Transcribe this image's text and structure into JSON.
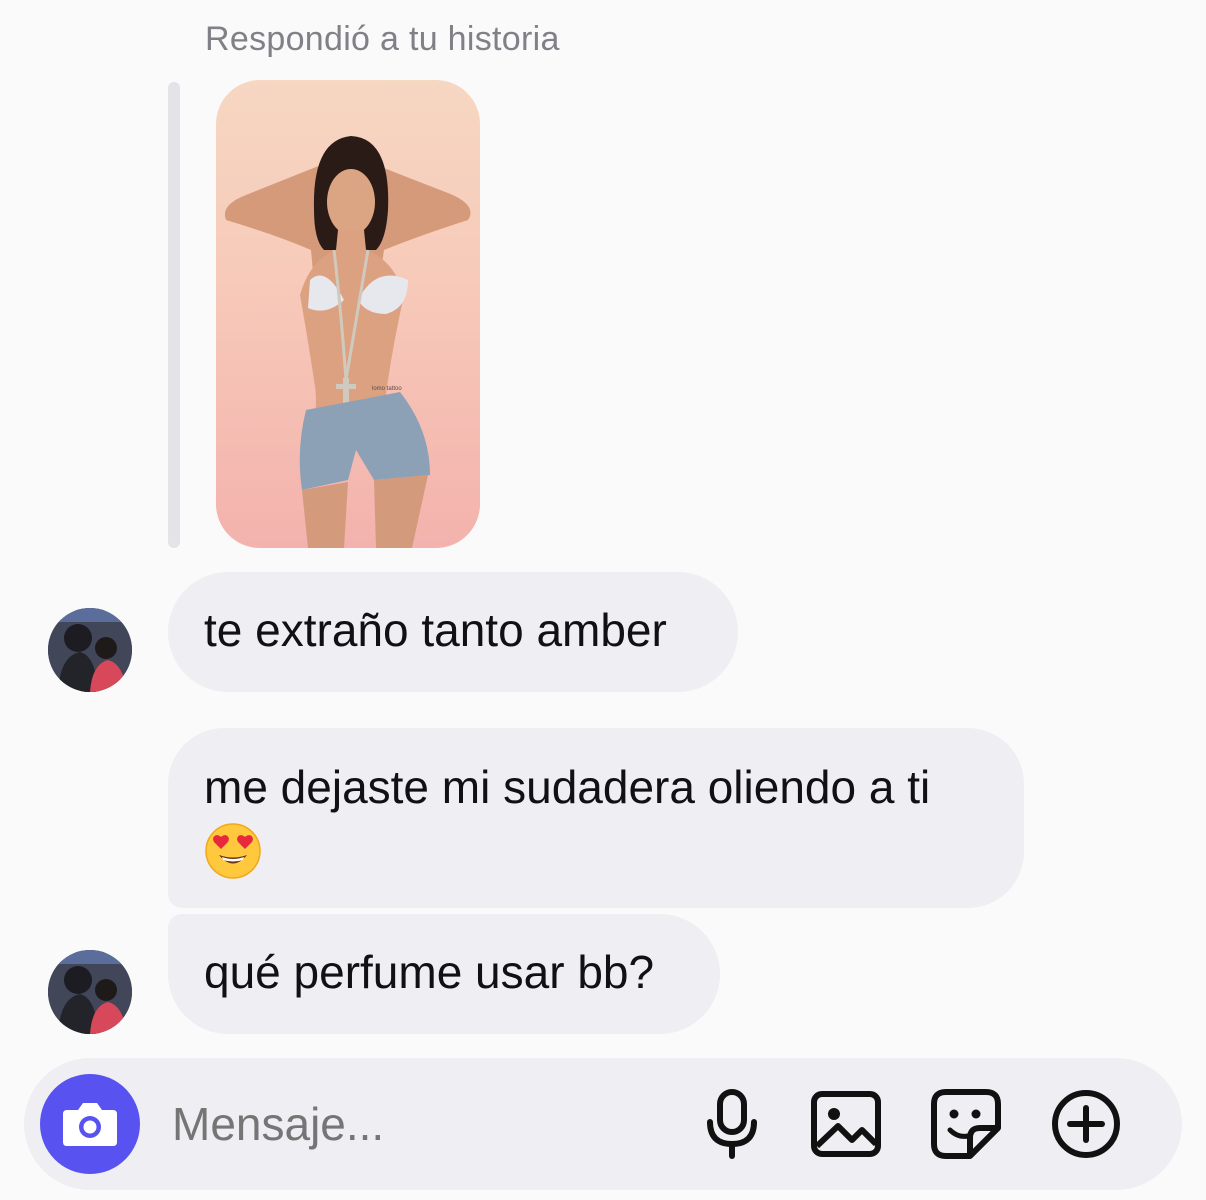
{
  "story_reply": {
    "caption": "Respondió a tu historia",
    "thumbnail_text": "lomo tattoo"
  },
  "messages": [
    {
      "text": "te extraño tanto amber"
    },
    {
      "line1": "me dejaste mi sudadera oliendo a ti",
      "emoji": "heart-eyes-emoji"
    },
    {
      "text": "qué perfume usar bb?"
    }
  ],
  "composer": {
    "placeholder": "Mensaje...",
    "icons": [
      "camera-icon",
      "microphone-icon",
      "image-icon",
      "sticker-icon",
      "plus-icon"
    ]
  },
  "colors": {
    "accent": "#5853f0",
    "bubble": "#efeff3",
    "background": "#fafafb",
    "caption": "#808086"
  }
}
